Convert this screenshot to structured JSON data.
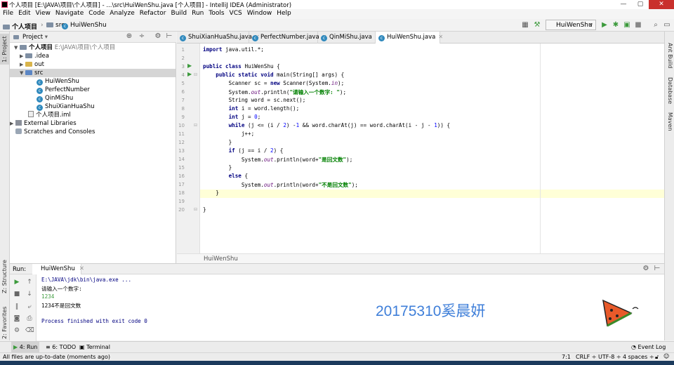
{
  "window": {
    "title": "个人项目 [E:\\JAVA\\项目\\个人项目] - ...\\src\\HuiWenShu.java [个人项目] - IntelliJ IDEA (Administrator)",
    "minimize": "—",
    "maximize": "▢",
    "close": "✕"
  },
  "menu": [
    "File",
    "Edit",
    "View",
    "Navigate",
    "Code",
    "Analyze",
    "Refactor",
    "Build",
    "Run",
    "Tools",
    "VCS",
    "Window",
    "Help"
  ],
  "navbar": {
    "project": "个人项目",
    "folder": "src",
    "file": "HuiWenShu",
    "run_config": "HuiWenShu"
  },
  "project_panel": {
    "header": "Project",
    "tree": [
      {
        "label": "个人项目",
        "hint": "E:\\JAVA\\项目\\个人项目",
        "level": 0,
        "expanded": true,
        "icon": "folder-icon"
      },
      {
        "label": ".idea",
        "level": 1,
        "expanded": false,
        "icon": "folder-icon"
      },
      {
        "label": "out",
        "level": 1,
        "expanded": false,
        "icon": "folder-icon"
      },
      {
        "label": "src",
        "level": 1,
        "expanded": true,
        "icon": "folder-icon",
        "selected": true
      },
      {
        "label": "HuiWenShu",
        "level": 2,
        "icon": "class-icon"
      },
      {
        "label": "PerfectNumber",
        "level": 2,
        "icon": "class-icon"
      },
      {
        "label": "QinMiShu",
        "level": 2,
        "icon": "class-icon"
      },
      {
        "label": "ShuiXianHuaShu",
        "level": 2,
        "icon": "class-icon"
      },
      {
        "label": "个人项目.iml",
        "level": 1,
        "icon": "iml-file-icon"
      },
      {
        "label": "External Libraries",
        "level": 0,
        "expanded": false,
        "icon": "library-icon"
      },
      {
        "label": "Scratches and Consoles",
        "level": 0,
        "icon": "scratches-icon"
      }
    ]
  },
  "editor": {
    "tabs": [
      {
        "label": "ShuiXianHuaShu.java",
        "active": false
      },
      {
        "label": "PerfectNumber.java",
        "active": false
      },
      {
        "label": "QinMiShu.java",
        "active": false
      },
      {
        "label": "HuiWenShu.java",
        "active": true
      }
    ],
    "line_numbers": [
      "1",
      "2",
      "3",
      "4",
      "5",
      "6",
      "7",
      "8",
      "9",
      "10",
      "11",
      "12",
      "13",
      "14",
      "15",
      "16",
      "17",
      "18",
      "19",
      "20"
    ],
    "code": [
      "import java.util.*;",
      "",
      "public class HuiWenShu {",
      "    public static void main(String[] args) {",
      "        Scanner sc = new Scanner(System.in);",
      "        System.out.println(\"请输入一个数字: \");",
      "        String word = sc.next();",
      "        int i = word.length();",
      "        int j = 0;",
      "        while (j <= (i / 2) -1 && word.charAt(j) == word.charAt(i - j - 1)) {",
      "            j++;",
      "        }",
      "        if (j == i / 2) {",
      "            System.out.println(word+\"是回文数\");",
      "        }",
      "        else {",
      "            System.out.println(word+\"不是回文数\");",
      "        }",
      "    }",
      "}"
    ],
    "breadcrumb": "HuiWenShu"
  },
  "run_panel": {
    "label": "Run:",
    "tab": "HuiWenShu",
    "output": [
      "E:\\JAVA\\jdk\\bin\\java.exe ...",
      "请输入一个数字:",
      "1234",
      "1234不是回文数",
      "",
      "Process finished with exit code 0"
    ]
  },
  "watermark_text": "20175310奚晨妍",
  "left_stripe": {
    "project": "1: Project",
    "structure": "Z: Structure",
    "favorites": "2: Favorites"
  },
  "right_stripe": {
    "ant": "Ant Build",
    "database": "Database",
    "maven": "Maven"
  },
  "bottom_tabs": {
    "run": "4: Run",
    "todo": "6: TODO",
    "terminal": "Terminal",
    "event_log": "Event Log"
  },
  "status": {
    "message": "All files are up-to-date (moments ago)",
    "position": "7:1",
    "line_sep": "CRLF ÷",
    "encoding": "UTF-8 ÷",
    "indent": "4 spaces ÷"
  },
  "colors": {
    "keyword": "#000080",
    "string": "#008000",
    "watermark": "#3f7fd9",
    "run_green": "#3c9a3c"
  }
}
